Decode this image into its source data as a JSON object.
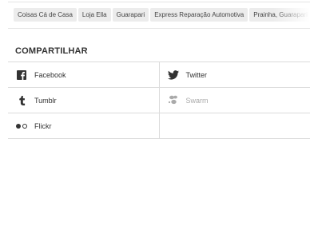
{
  "tags": [
    "Coisas Cá de Casa",
    "Loja Ella",
    "Guarapari",
    "Express Reparação Automotiva",
    "Prainha, Guarapari"
  ],
  "share": {
    "title": "COMPARTILHAR",
    "facebook": "Facebook",
    "twitter": "Twitter",
    "tumblr": "Tumblr",
    "swarm": "Swarm",
    "flickr": "Flickr"
  },
  "colors": {
    "tag_bg": "#ececec",
    "text": "#333333",
    "disabled": "#aaaaaa",
    "divider": "#dcdcdc"
  }
}
